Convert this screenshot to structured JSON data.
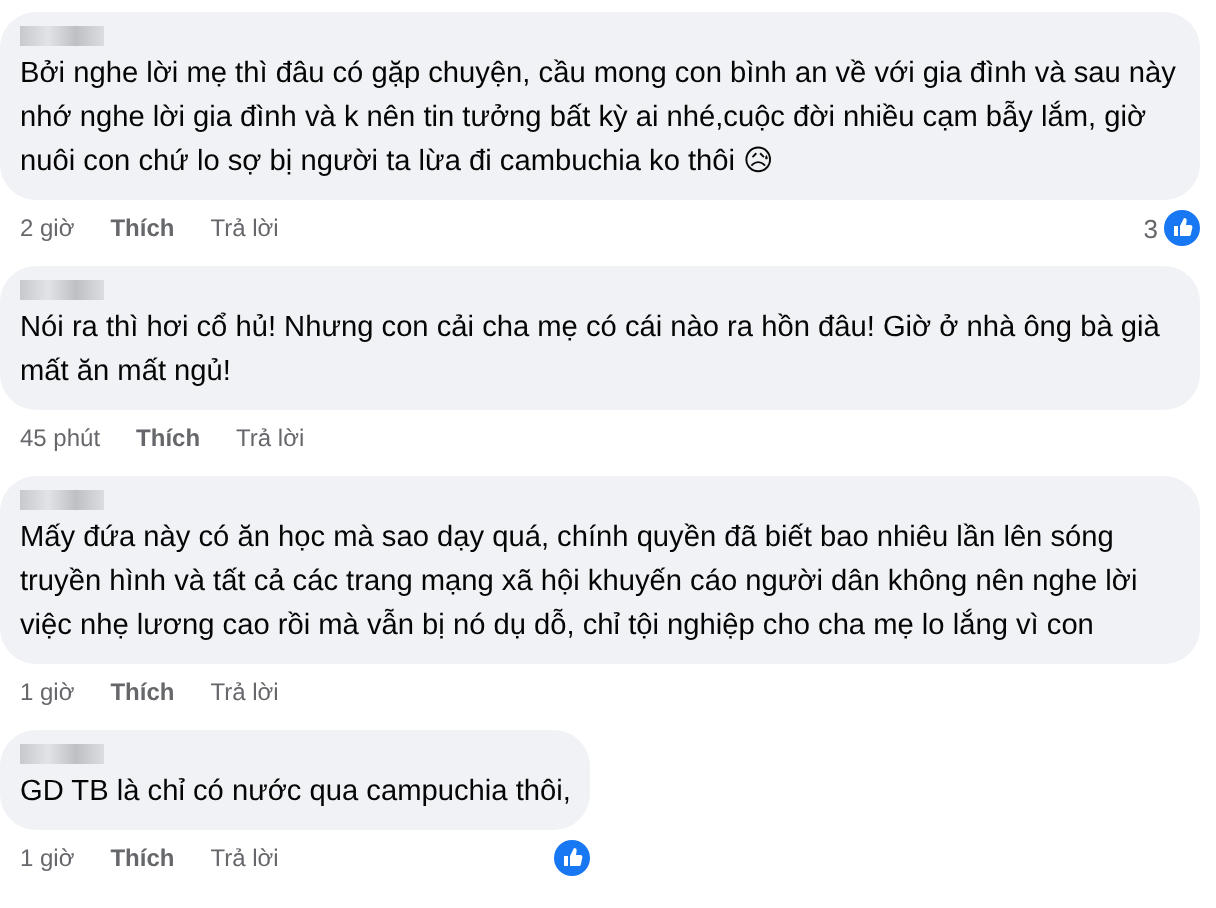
{
  "comments": [
    {
      "text": "Bởi nghe lời mẹ thì đâu có gặp chuyện, cầu mong con bình an về với gia đình và sau này nhớ nghe lời gia đình và k nên tin tưởng bất kỳ ai nhé,cuộc đời nhiều cạm bẫy lắm, giờ nuôi con chứ lo sợ bị người ta lừa đi cambuchia ko thôi",
      "emoji": "😥",
      "time": "2 giờ",
      "like": "Thích",
      "reply": "Trả lời",
      "liked": true,
      "reaction_count": "3"
    },
    {
      "text": "Nói ra thì hơi cổ hủ! Nhưng con cải cha mẹ có cái nào ra hồn đâu! Giờ ở nhà ông bà già mất ăn mất ngủ!",
      "time": "45 phút",
      "like": "Thích",
      "reply": "Trả lời",
      "liked": false
    },
    {
      "text": "Mấy đứa này có ăn học mà sao dạy quá, chính quyền đã biết bao nhiêu lần lên sóng truyền hình và tất cả các trang mạng xã hội khuyến cáo người dân không nên nghe lời việc nhẹ lương cao rồi mà vẫn bị nó dụ dỗ, chỉ tội nghiệp cho cha mẹ lo lắng vì con",
      "time": "1 giờ",
      "like": "Thích",
      "reply": "Trả lời",
      "liked": false
    },
    {
      "text": "GD TB là chỉ có nước qua campuchia thôi,",
      "time": "1 giờ",
      "like": "Thích",
      "reply": "Trả lời",
      "liked": true
    }
  ]
}
